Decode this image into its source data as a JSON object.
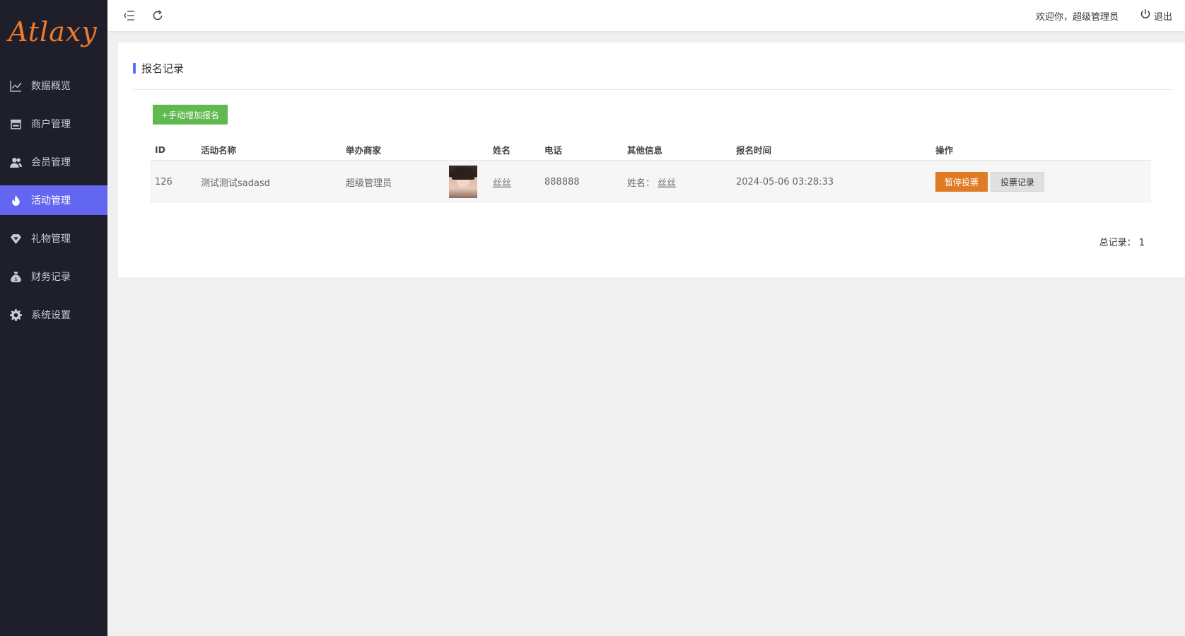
{
  "logo": "Atlaxy",
  "sidebar": {
    "items": [
      {
        "label": "数据概览",
        "icon": "chart-line-icon"
      },
      {
        "label": "商户管理",
        "icon": "store-icon"
      },
      {
        "label": "会员管理",
        "icon": "users-icon"
      },
      {
        "label": "活动管理",
        "icon": "flame-icon",
        "active": true
      },
      {
        "label": "礼物管理",
        "icon": "gem-icon"
      },
      {
        "label": "财务记录",
        "icon": "money-bag-icon"
      },
      {
        "label": "系统设置",
        "icon": "gear-icon"
      }
    ]
  },
  "topbar": {
    "welcome": "欢迎你，超级管理员",
    "logout": "退出"
  },
  "page": {
    "title": "报名记录",
    "add_button": "+手动增加报名",
    "total_label": "总记录：",
    "total_count": "1"
  },
  "table": {
    "headers": [
      "ID",
      "活动名称",
      "举办商家",
      "",
      "姓名",
      "电话",
      "其他信息",
      "报名时间",
      "操作"
    ],
    "rows": [
      {
        "id": "126",
        "activity": "测试测试sadasd",
        "merchant": "超级管理员",
        "name": "丝丝",
        "phone": "888888",
        "other_label": "姓名：",
        "other_value": "丝丝",
        "time": "2024-05-06 03:28:33",
        "op_pause": "暂停投票",
        "op_record": "投票记录"
      }
    ]
  },
  "colors": {
    "sidebar_bg": "#1f1f2b",
    "active": "#6366f1",
    "logo": "#f07a2a",
    "add_button": "#5fb94e",
    "pause_button": "#e07b24"
  }
}
